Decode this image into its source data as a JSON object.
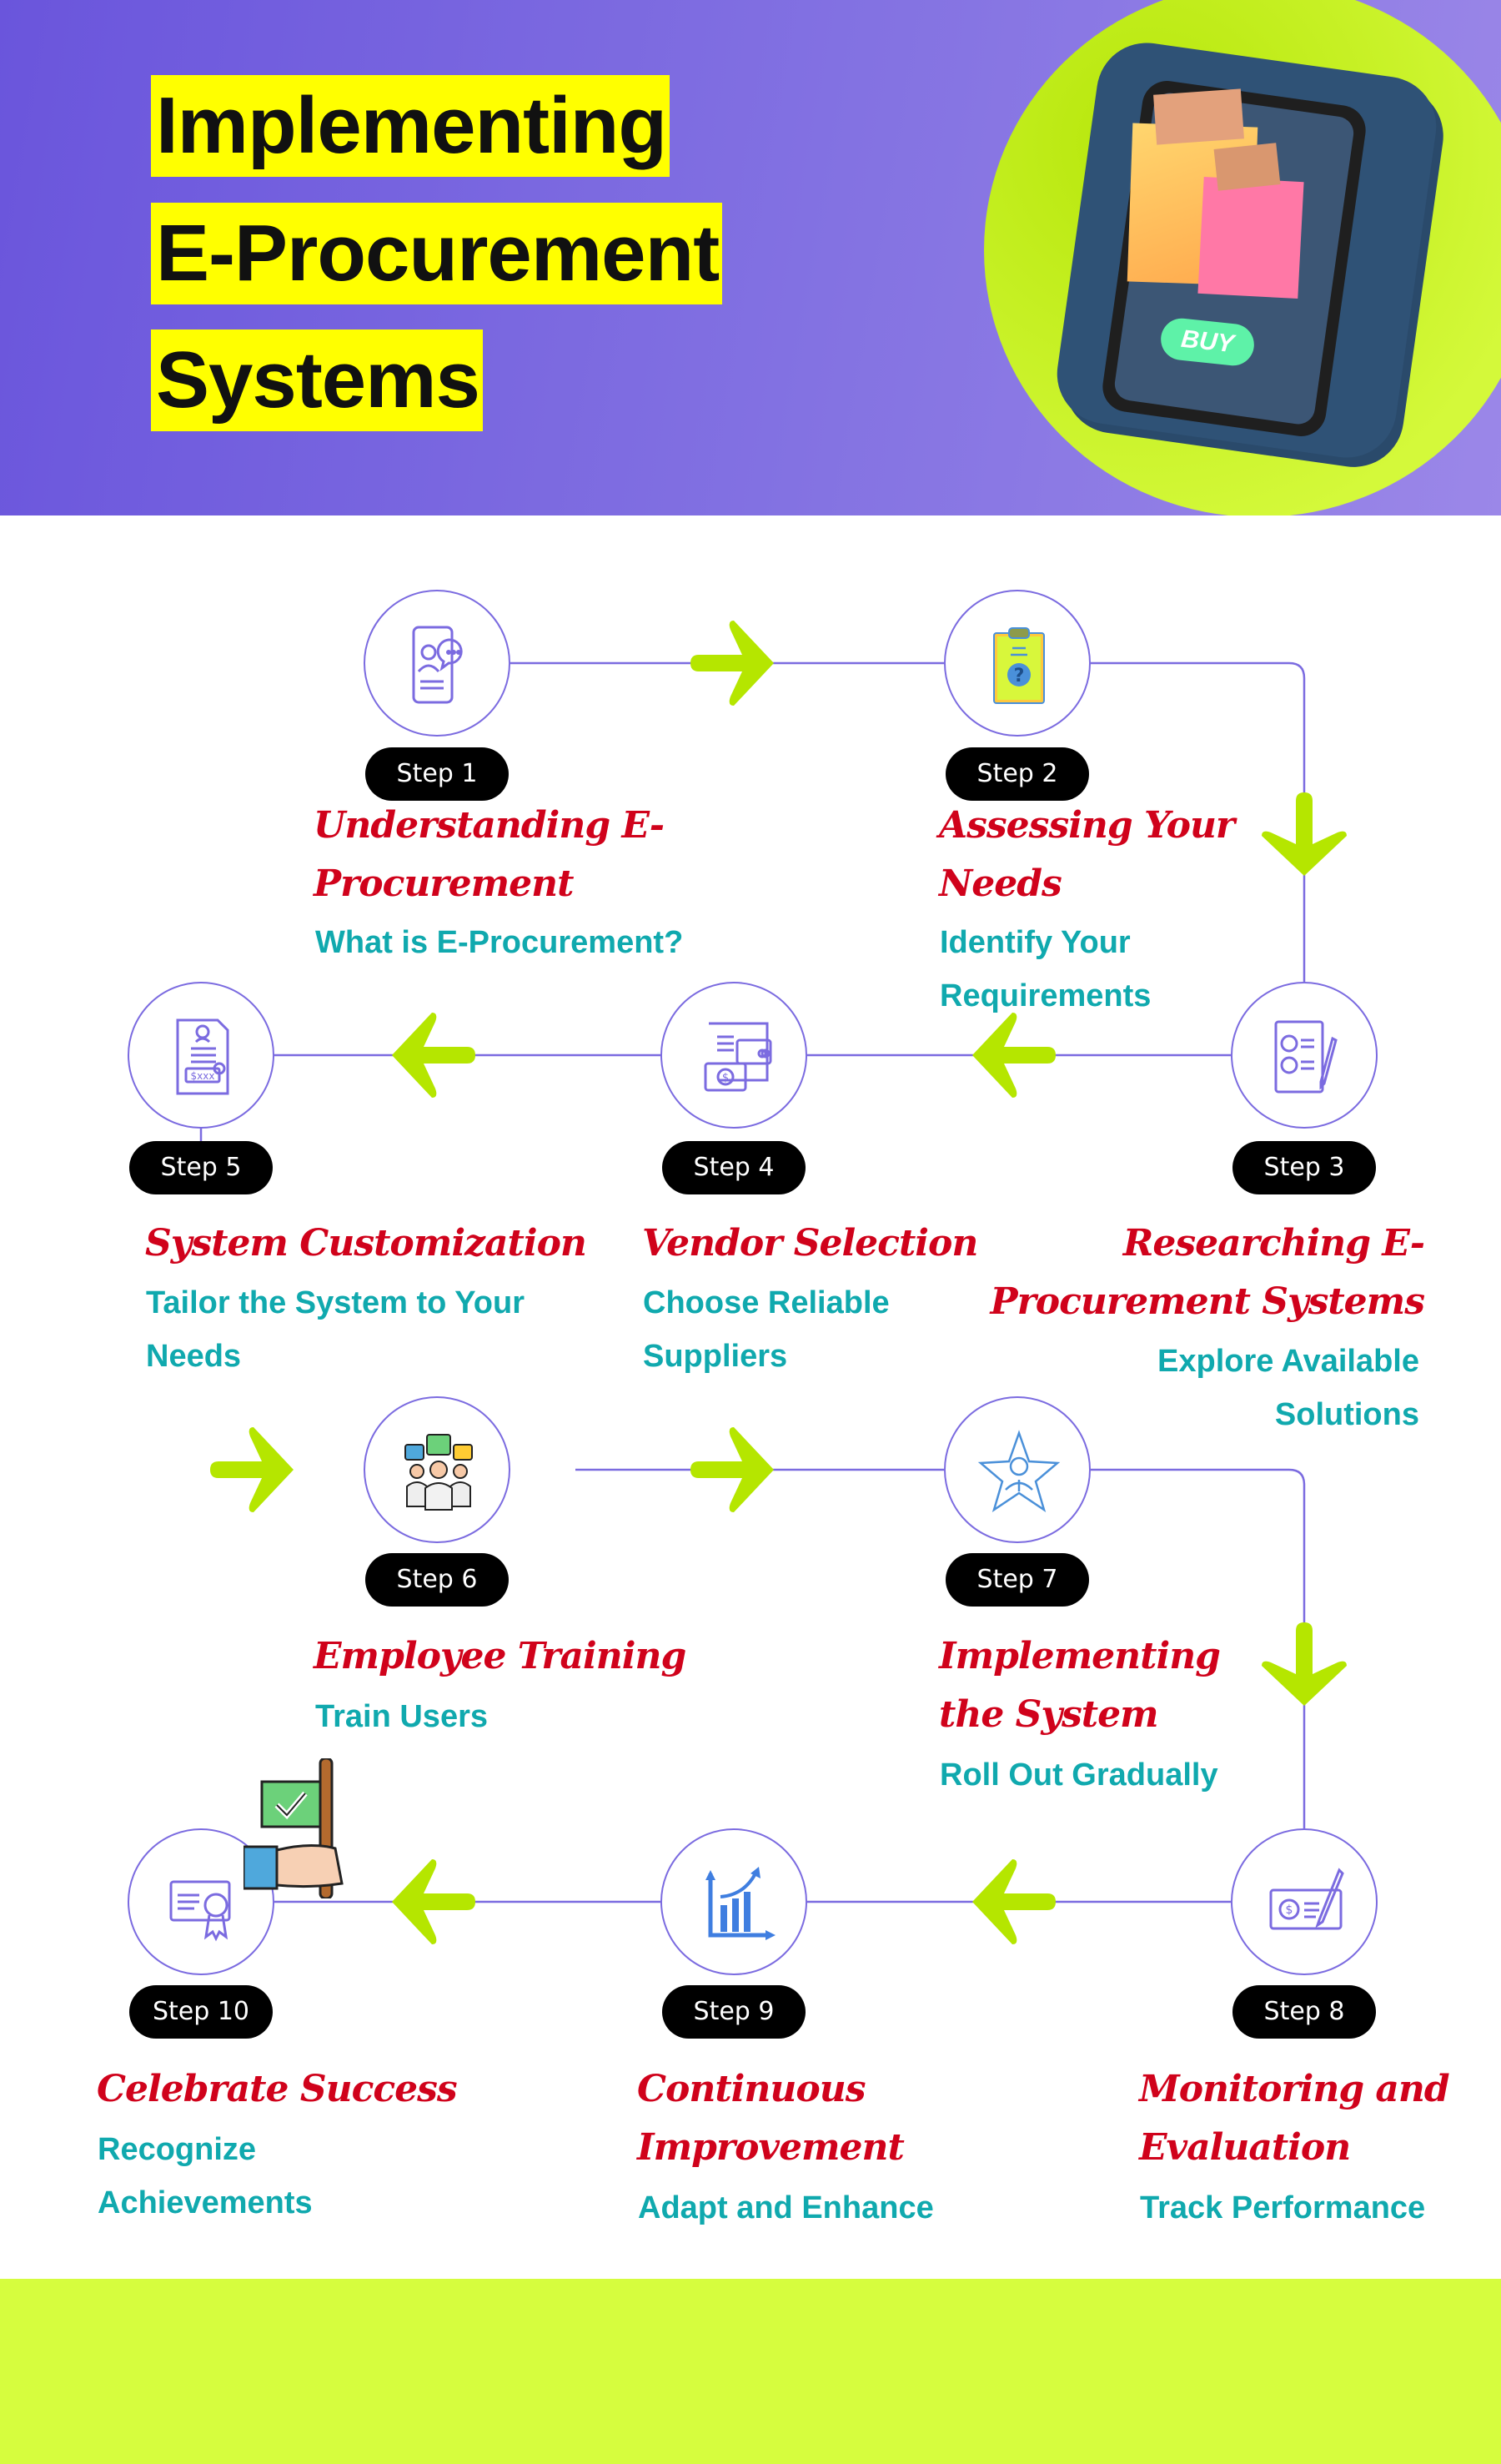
{
  "header": {
    "title_lines": [
      "Implementing",
      "E-Procurement",
      "Systems"
    ],
    "hero_button_label": "BUY",
    "hero_image": "smartphone-with-shopping-bags-illustration"
  },
  "colors": {
    "header_gradient_start": "#6a55dc",
    "header_gradient_end": "#9b87e8",
    "title_highlight": "#ffff00",
    "hero_circle": "#c8f020",
    "connector_line": "#7b6be0",
    "arrow": "#b5e600",
    "step_pill": "#000000",
    "step_title": "#d0021b",
    "step_subtitle": "#10a9ae",
    "footer_band": "#d6fd3e"
  },
  "steps": [
    {
      "label": "Step 1",
      "title_lines": [
        "Understanding E-",
        "Procurement"
      ],
      "subtitle_lines": [
        "What is E-Procurement?"
      ],
      "icon": "smartphone-chat-icon"
    },
    {
      "label": "Step 2",
      "title_lines": [
        "Assessing Your",
        "Needs"
      ],
      "subtitle_lines": [
        "Identify Your",
        "Requirements"
      ],
      "icon": "clipboard-question-icon"
    },
    {
      "label": "Step 3",
      "title_lines": [
        "Researching E-",
        "Procurement Systems"
      ],
      "subtitle_lines": [
        "Explore Available",
        "Solutions"
      ],
      "icon": "checklist-pen-icon"
    },
    {
      "label": "Step 4",
      "title_lines": [
        "Vendor Selection"
      ],
      "subtitle_lines": [
        "Choose Reliable",
        "Suppliers"
      ],
      "icon": "invoice-payment-icon"
    },
    {
      "label": "Step 5",
      "title_lines": [
        "System Customization"
      ],
      "subtitle_lines": [
        "Tailor the System to Your",
        "Needs"
      ],
      "icon": "document-price-icon"
    },
    {
      "label": "Step 6",
      "title_lines": [
        "Employee Training"
      ],
      "subtitle_lines": [
        "Train Users"
      ],
      "icon": "team-discussion-icon"
    },
    {
      "label": "Step 7",
      "title_lines": [
        "Implementing",
        "the System"
      ],
      "subtitle_lines": [
        "Roll Out Gradually"
      ],
      "icon": "star-employee-icon"
    },
    {
      "label": "Step 8",
      "title_lines": [
        "Monitoring and",
        "Evaluation"
      ],
      "subtitle_lines": [
        "Track Performance"
      ],
      "icon": "signed-check-icon"
    },
    {
      "label": "Step 9",
      "title_lines": [
        "Continuous",
        "Improvement"
      ],
      "subtitle_lines": [
        "Adapt and Enhance"
      ],
      "icon": "growth-chart-icon"
    },
    {
      "label": "Step 10",
      "title_lines": [
        "Celebrate Success"
      ],
      "subtitle_lines": [
        "Recognize",
        "Achievements"
      ],
      "icon": "certificate-flag-icon"
    }
  ]
}
